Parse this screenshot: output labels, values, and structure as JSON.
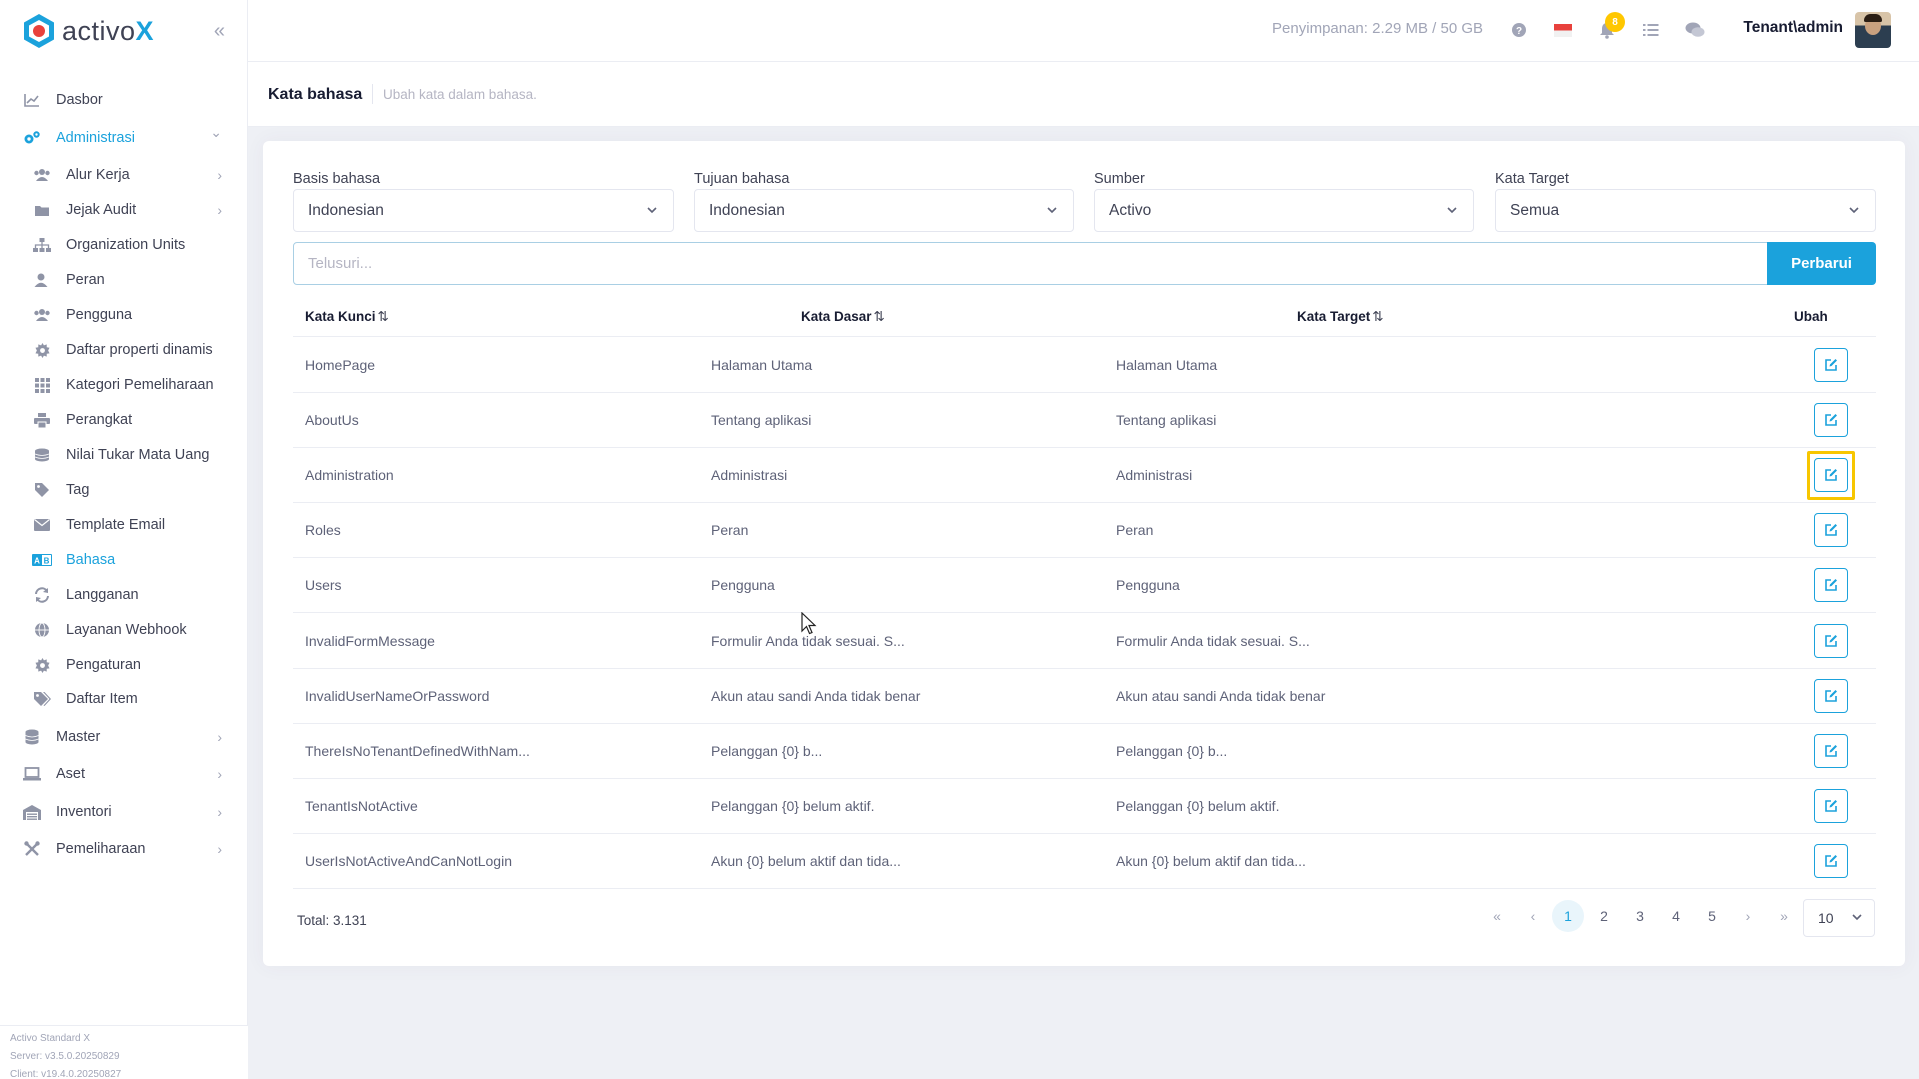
{
  "app": {
    "logo_text": "activo",
    "logo_x": "X",
    "accent_color": "#1ba2dc",
    "highlight_color": "#f7c600"
  },
  "topbar": {
    "storage": "Penyimpanan: 2.29 MB / 50 GB",
    "notification_count": "8",
    "user": "Tenant\\admin",
    "icons": [
      "help-icon",
      "flag-icon",
      "bell-icon",
      "tasks-icon",
      "chat-icon"
    ]
  },
  "sidebar": {
    "items": [
      {
        "label": "Dasbor",
        "icon": "chart-icon",
        "level": "top"
      },
      {
        "label": "Administrasi",
        "icon": "cogs-icon",
        "level": "top",
        "active": true,
        "expanded": true
      },
      {
        "label": "Alur Kerja",
        "icon": "users-icon",
        "level": "sub",
        "chevron": true
      },
      {
        "label": "Jejak Audit",
        "icon": "folder-icon",
        "level": "sub",
        "chevron": true
      },
      {
        "label": "Organization Units",
        "icon": "sitemap-icon",
        "level": "sub"
      },
      {
        "label": "Peran",
        "icon": "user-tag-icon",
        "level": "sub"
      },
      {
        "label": "Pengguna",
        "icon": "users-icon",
        "level": "sub"
      },
      {
        "label": "Daftar properti dinamis",
        "icon": "gear-icon",
        "level": "sub"
      },
      {
        "label": "Kategori Pemeliharaan",
        "icon": "grid-icon",
        "level": "sub"
      },
      {
        "label": "Perangkat",
        "icon": "printer-icon",
        "level": "sub"
      },
      {
        "label": "Nilai Tukar Mata Uang",
        "icon": "coins-icon",
        "level": "sub"
      },
      {
        "label": "Tag",
        "icon": "tag-icon",
        "level": "sub"
      },
      {
        "label": "Template Email",
        "icon": "envelope-icon",
        "level": "sub"
      },
      {
        "label": "Bahasa",
        "icon": "language-icon",
        "level": "sub",
        "active": true
      },
      {
        "label": "Langganan",
        "icon": "sync-icon",
        "level": "sub"
      },
      {
        "label": "Layanan Webhook",
        "icon": "globe-icon",
        "level": "sub"
      },
      {
        "label": "Pengaturan",
        "icon": "gear-icon",
        "level": "sub"
      },
      {
        "label": "Daftar Item",
        "icon": "tags-icon",
        "level": "sub"
      },
      {
        "label": "Master",
        "icon": "database-icon",
        "level": "top",
        "chevron": true
      },
      {
        "label": "Aset",
        "icon": "laptop-icon",
        "level": "top",
        "chevron": true
      },
      {
        "label": "Inventori",
        "icon": "warehouse-icon",
        "level": "top",
        "chevron": true
      },
      {
        "label": "Pemeliharaan",
        "icon": "tools-icon",
        "level": "top",
        "chevron": true
      }
    ],
    "footer": [
      "Activo Standard X",
      "Server: v3.5.0.20250829",
      "Client: v19.4.0.20250827"
    ]
  },
  "subheader": {
    "title": "Kata bahasa",
    "description": "Ubah kata dalam bahasa."
  },
  "filters": [
    {
      "label": "Basis bahasa",
      "value": "Indonesian"
    },
    {
      "label": "Tujuan bahasa",
      "value": "Indonesian"
    },
    {
      "label": "Sumber",
      "value": "Activo"
    },
    {
      "label": "Kata Target",
      "value": "Semua"
    }
  ],
  "search": {
    "placeholder": "Telusuri...",
    "button": "Perbarui"
  },
  "table": {
    "columns": [
      "Kata Kunci",
      "Kata Dasar",
      "Kata Target",
      "Ubah"
    ],
    "rows": [
      [
        "HomePage",
        "Halaman Utama",
        "Halaman Utama"
      ],
      [
        "AboutUs",
        "Tentang aplikasi",
        "Tentang aplikasi"
      ],
      [
        "Administration",
        "Administrasi",
        "Administrasi"
      ],
      [
        "Roles",
        "Peran",
        "Peran"
      ],
      [
        "Users",
        "Pengguna",
        "Pengguna"
      ],
      [
        "InvalidFormMessage",
        "Formulir Anda tidak sesuai. S...",
        "Formulir Anda tidak sesuai. S..."
      ],
      [
        "InvalidUserNameOrPassword",
        "Akun atau sandi Anda tidak benar",
        "Akun atau sandi Anda tidak benar"
      ],
      [
        "ThereIsNoTenantDefinedWithNam...",
        "Pelanggan {0} b...",
        "Pelanggan {0} b..."
      ],
      [
        "TenantIsNotActive",
        "Pelanggan {0} belum aktif.",
        "Pelanggan {0} belum aktif."
      ],
      [
        "UserIsNotActiveAndCanNotLogin",
        "Akun {0} belum aktif dan tida...",
        "Akun {0} belum aktif dan tida..."
      ]
    ],
    "highlighted_row": 2
  },
  "pagination": {
    "total": "Total: 3.131",
    "pages": [
      "1",
      "2",
      "3",
      "4",
      "5"
    ],
    "current": "1",
    "page_size": "10"
  }
}
